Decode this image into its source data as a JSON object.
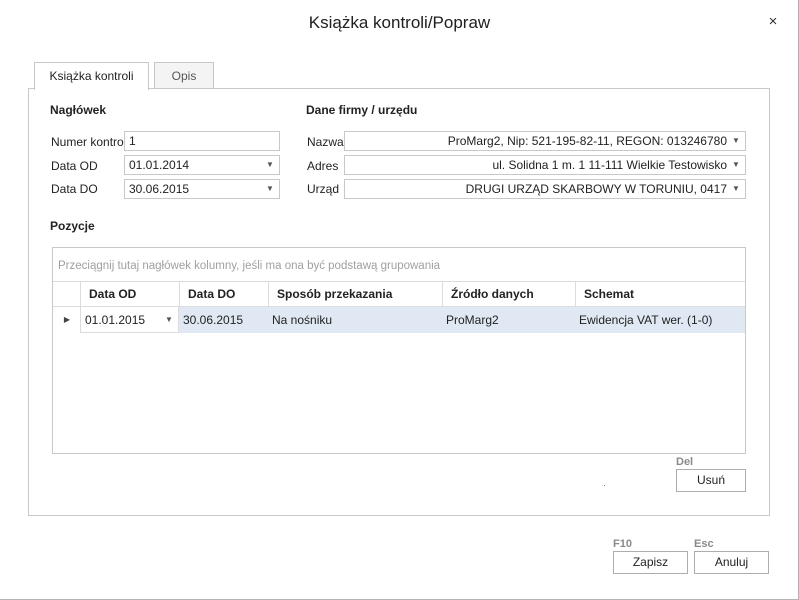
{
  "window": {
    "title": "Książka kontroli/Popraw",
    "close_label": "×"
  },
  "tabs": [
    {
      "label": "Książka kontroli",
      "active": true
    },
    {
      "label": "Opis",
      "active": false
    }
  ],
  "header_section": {
    "title": "Nagłówek",
    "numer_kontroli": {
      "label": "Numer kontroli",
      "value": "1"
    },
    "data_od": {
      "label": "Data OD",
      "value": "01.01.2014"
    },
    "data_do": {
      "label": "Data DO",
      "value": "30.06.2015"
    }
  },
  "company_section": {
    "title": "Dane firmy / urzędu",
    "nazwa": {
      "label": "Nazwa",
      "value": "ProMarg2, Nip: 521-195-82-11, REGON: 013246780"
    },
    "adres": {
      "label": "Adres",
      "value": "ul. Solidna 1 m. 1 11-111 Wielkie Testowisko"
    },
    "urzad": {
      "label": "Urząd",
      "value": "DRUGI URZĄD SKARBOWY W TORUNIU, 0417"
    }
  },
  "positions": {
    "title": "Pozycje",
    "group_hint": "Przeciągnij tutaj nagłówek kolumny, jeśli ma ona być podstawą grupowania",
    "columns": [
      "Data OD",
      "Data DO",
      "Sposób przekazania",
      "Źródło danych",
      "Schemat"
    ],
    "rows": [
      {
        "data_od": "01.01.2015",
        "data_do": "30.06.2015",
        "sposob": "Na nośniku",
        "zrodlo": "ProMarg2",
        "schemat": "Ewidencja VAT  wer. (1-0)"
      }
    ]
  },
  "actions": {
    "delete": {
      "hotkey": "Del",
      "label": "Usuń"
    },
    "save": {
      "hotkey": "F10",
      "label": "Zapisz"
    },
    "cancel": {
      "hotkey": "Esc",
      "label": "Anuluj"
    }
  },
  "icons": {
    "dropdown": "chevron-down-icon",
    "row_indicator": "row-pointer-icon"
  },
  "colors": {
    "selected_row": "#dfe8f3",
    "border": "#c8c8c8",
    "hint_text": "#a0a0a0"
  }
}
